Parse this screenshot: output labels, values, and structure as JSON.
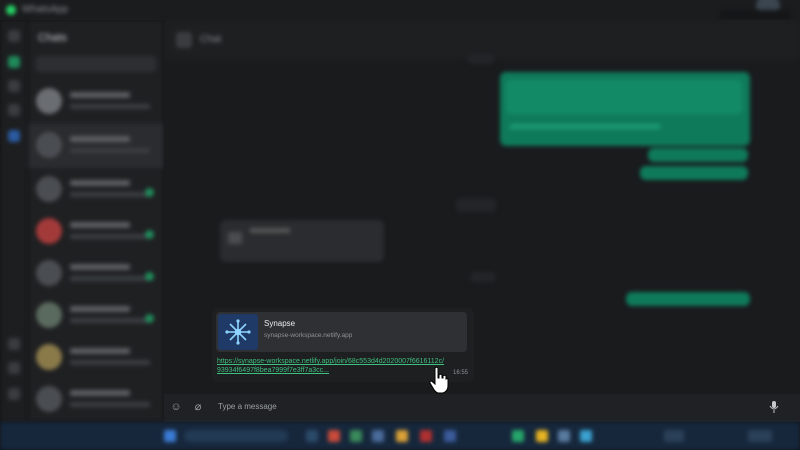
{
  "window": {
    "app_title": "WhatsApp"
  },
  "chat_list": {
    "header": "Chats"
  },
  "chat": {
    "contact_name": "Chat"
  },
  "message": {
    "preview_title": "Synapse",
    "preview_domain": "synapse-workspace.netlify.app",
    "link": "https://synapse-workspace.netlify.app/join/68c553d4d2020007f6616112c/93934f6497f8bea7999f7e3ff7a3cc...",
    "time": "16:55"
  },
  "composer": {
    "placeholder": "Type a message"
  },
  "colors": {
    "accent": "#25d366",
    "outgoing_bubble": "#0f7a5a",
    "link": "#3fbf7f",
    "background": "#1a1b1d"
  },
  "icons": [
    "emoji-icon",
    "attach-icon",
    "mic-icon",
    "synapse-logo-icon",
    "hand-cursor-icon"
  ]
}
